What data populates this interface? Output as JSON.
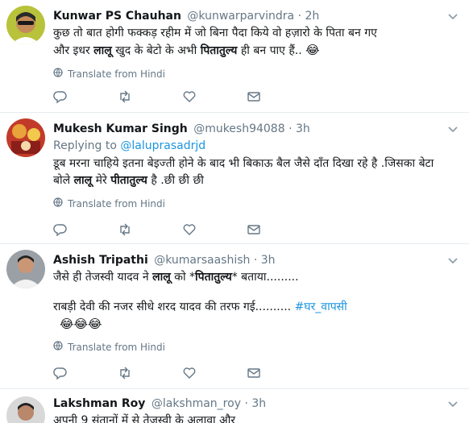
{
  "tweets": [
    {
      "name": "Kunwar PS Chauhan",
      "handle": "@kunwarparvindra",
      "dot": "·",
      "time": "2h",
      "lines": [
        {
          "pre": "कुछ तो बात होगी फक्कड़ रहीम में जो बिना पैदा किये वो हज़ारो के पिता बन गए",
          "b1": "",
          "mid": "",
          "b2": "",
          "post": ""
        },
        {
          "pre": "और इधर ",
          "b1": "लालू",
          "mid": " खुद के बेटो के अभी ",
          "b2": "पितातुल्य",
          "post": " ही बन पाए हैं.. "
        }
      ],
      "emoji": "😂",
      "translate": "Translate from Hindi",
      "avatar_colors": {
        "bg": "#b8c23a",
        "skin": "#c58a5a",
        "hair": "#2a2a2a"
      }
    },
    {
      "name": "Mukesh Kumar Singh",
      "handle": "@mukesh94088",
      "dot": "·",
      "time": "3h",
      "replying_prefix": "Replying to ",
      "replying_handle": "@laluprasadrjd",
      "lines": [
        {
          "pre": "डूब मरना चाहिये इतना बेइज्ती होने के बाद भी बिकाऊ बैल जैसे दाँत दिखा रहे है .जिसका बेटा",
          "b1": "",
          "mid": "",
          "b2": "",
          "post": ""
        },
        {
          "pre": "बोले ",
          "b1": "लालू",
          "mid": " मेरे ",
          "b2": "पीतातुल्य",
          "post": " है .छी छी छी"
        }
      ],
      "translate": "Translate from Hindi",
      "avatar_colors": {
        "bg": "#c23b2a",
        "accent": "#e8a33a"
      }
    },
    {
      "name": "Ashish Tripathi",
      "handle": "@kumarsaashish",
      "dot": "·",
      "time": "3h",
      "line1": {
        "pre": "जैसे ही तेजस्वी यादव ने ",
        "b1": "लालू",
        "mid": " को *",
        "b2": "पितातुल्य",
        "post": "* बताया........."
      },
      "line2": {
        "pre": "राबड़ी देवी की नजर सीधे शरद यादव की तरफ गई.......... ",
        "hashtag": "#घर_वापसी"
      },
      "emoji": "😂😂😂",
      "translate": "Translate from Hindi",
      "avatar_colors": {
        "bg": "#9aa0a6",
        "skin": "#c99676",
        "shirt": "#f2f2f2"
      }
    },
    {
      "name": "Lakshman Roy",
      "handle": "@lakshman_roy",
      "dot": "·",
      "time": "3h",
      "line1": "अपनी 9 संतानों में से तेजस्वी के अलावा और",
      "avatar_colors": {
        "bg": "#d8d8d8",
        "skin": "#b9876a",
        "hair": "#222222"
      }
    }
  ],
  "icons": [
    "reply-icon",
    "retweet-icon",
    "like-icon",
    "message-icon",
    "globe-icon",
    "caret-down-icon"
  ],
  "colors": {
    "link": "#1b95e0",
    "secondary": "#657786",
    "border": "#e6ecf0",
    "text": "#14171a"
  }
}
